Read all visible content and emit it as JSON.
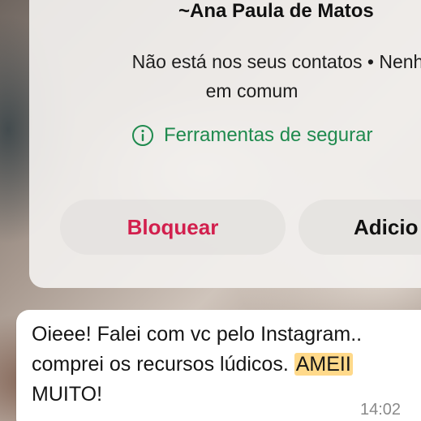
{
  "contact": {
    "name": "~Ana Paula de Matos",
    "status_line1": "Não está nos seus contatos • Nenh",
    "status_line2": "em comum"
  },
  "safety": {
    "label": "Ferramentas de segurar",
    "icon": "info-icon",
    "color": "#1f8a4e"
  },
  "actions": {
    "block_label": "Bloquear",
    "block_color": "#d21f4d",
    "add_label": "Adicio"
  },
  "message": {
    "text_before": "Oieee! Falei com vc pelo Instagram.. comprei os recursos lúdicos. ",
    "highlight": "AMEII",
    "text_after": " MUITO!",
    "time": "14:02"
  }
}
